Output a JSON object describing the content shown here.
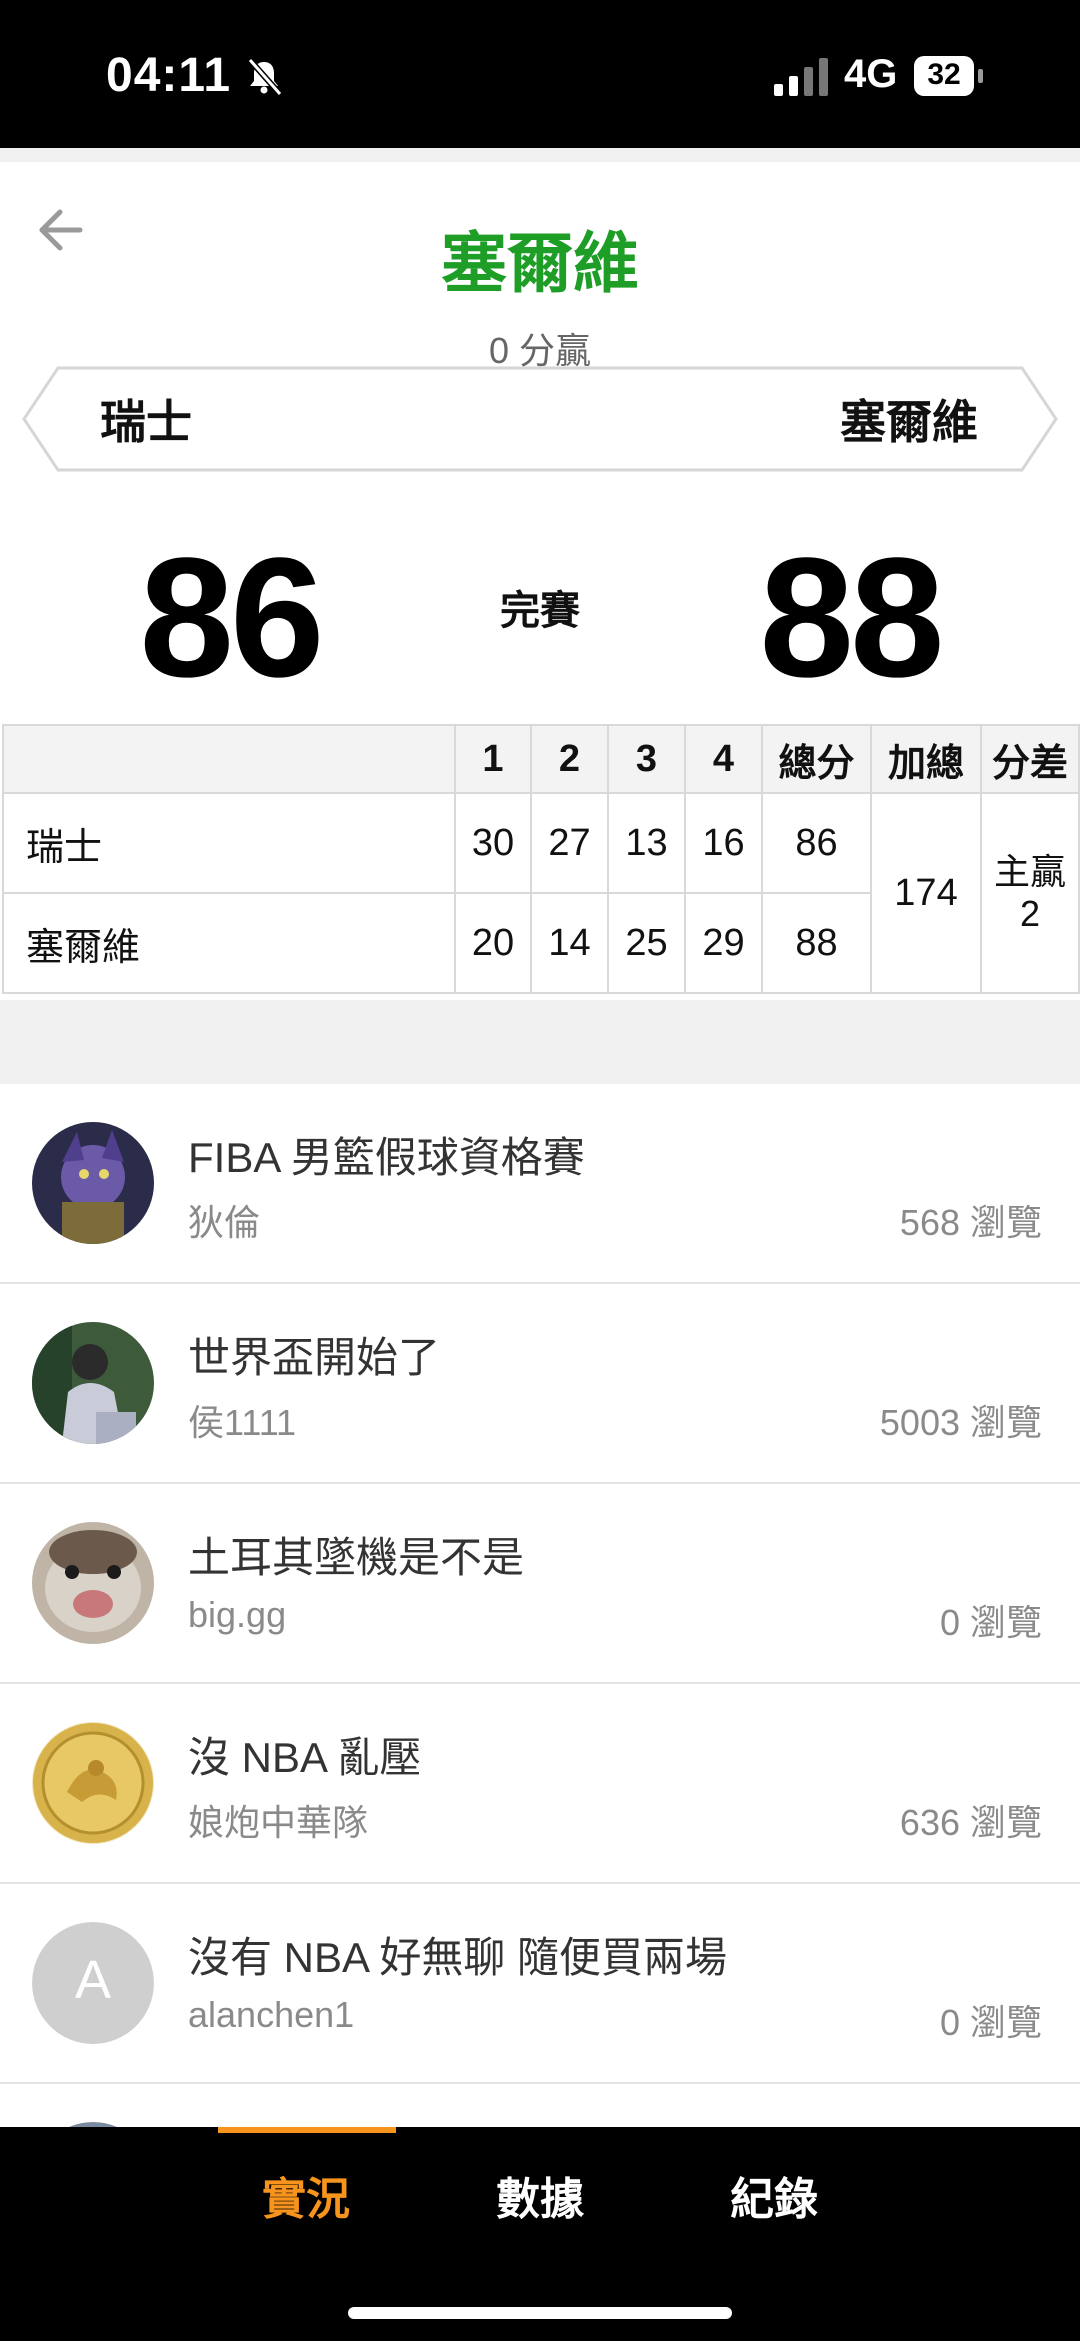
{
  "status_bar": {
    "time": "04:11",
    "network": "4G",
    "battery": "32"
  },
  "header": {
    "winner": "塞爾維",
    "margin": "0 分贏"
  },
  "matchup": {
    "team_left": "瑞士",
    "team_right": "塞爾維",
    "score_left": "86",
    "score_right": "88",
    "status": "完賽"
  },
  "box_score": {
    "headers": [
      "",
      "1",
      "2",
      "3",
      "4",
      "總分",
      "加總",
      "分差"
    ],
    "rows": [
      {
        "team": "瑞士",
        "q": [
          "30",
          "27",
          "13",
          "16"
        ],
        "total": "86"
      },
      {
        "team": "塞爾維",
        "q": [
          "20",
          "14",
          "25",
          "29"
        ],
        "total": "88"
      }
    ],
    "combined": "174",
    "diff_label": "主贏",
    "diff_value": "2"
  },
  "posts": [
    {
      "title": "FIBA 男籃假球資格賽",
      "author": "狄倫",
      "views": "568 瀏覽",
      "avatar": "character-avatar"
    },
    {
      "title": "世界盃開始了",
      "author": "侯1111",
      "views": "5003 瀏覽",
      "avatar": "person-avatar"
    },
    {
      "title": "土耳其墜機是不是",
      "author": "big.gg",
      "views": "0 瀏覽",
      "avatar": "animal-avatar"
    },
    {
      "title": "沒 NBA 亂壓",
      "author": "娘炮中華隊",
      "views": "636 瀏覽",
      "avatar": "coin-avatar"
    },
    {
      "title": "沒有 NBA 好無聊 隨便買兩場",
      "author": "alanchen1",
      "views": "0 瀏覽",
      "avatar_letter": "A"
    }
  ],
  "tabs": [
    {
      "label": "實況",
      "active": true
    },
    {
      "label": "數據",
      "active": false
    },
    {
      "label": "紀錄",
      "active": false
    }
  ],
  "colors": {
    "winner_green": "#1f9e27",
    "tab_active": "#f7941d"
  }
}
